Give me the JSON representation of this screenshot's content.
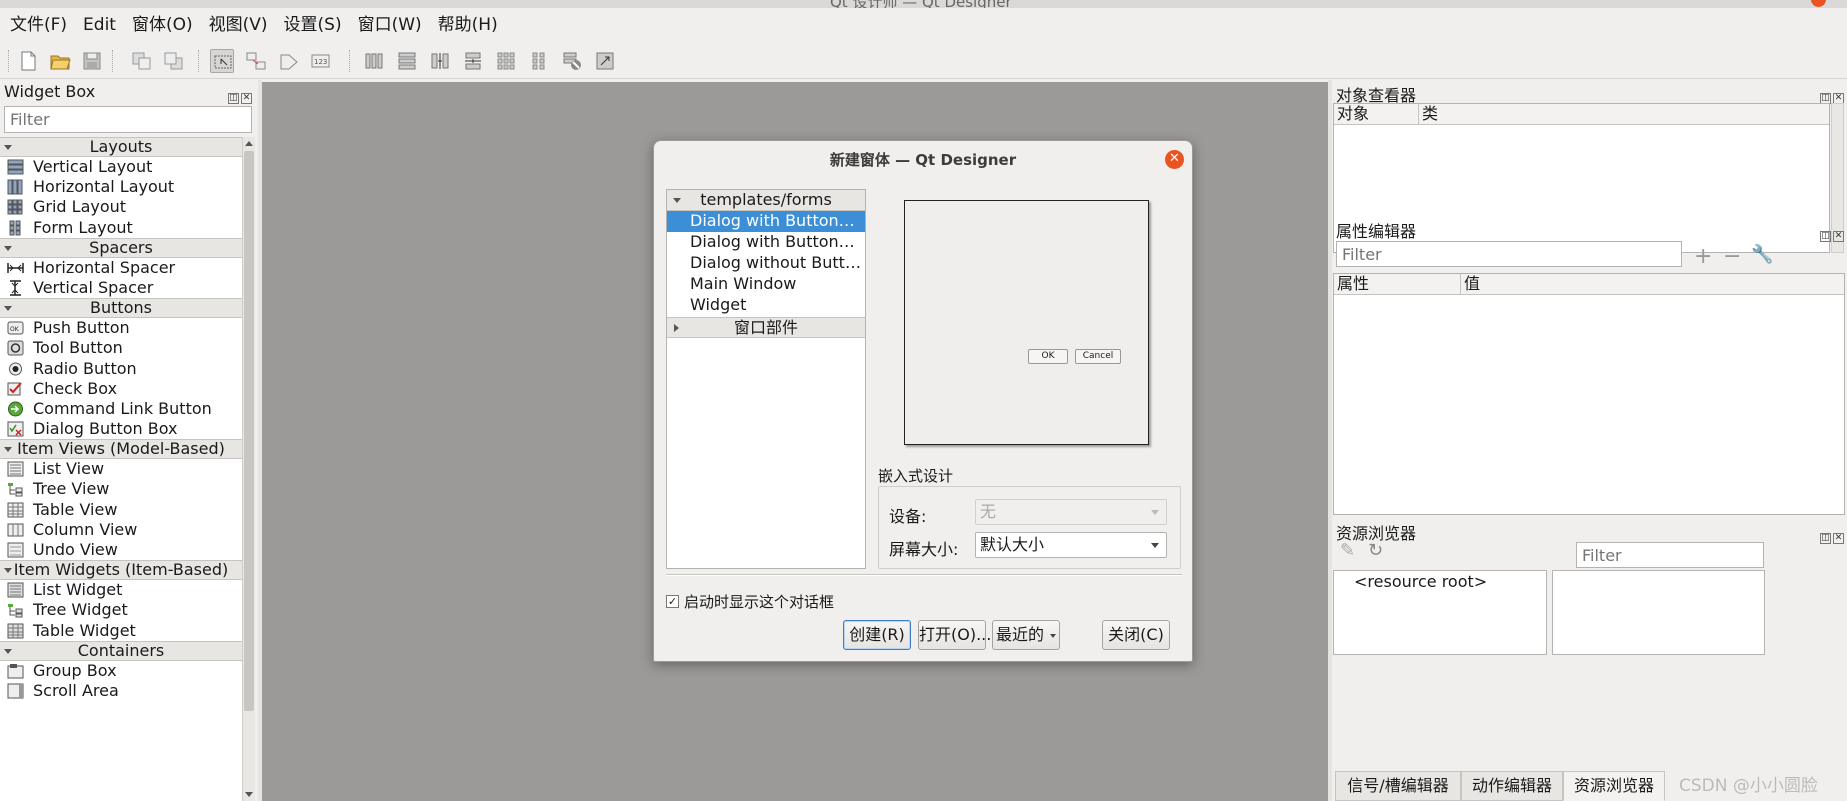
{
  "window": {
    "title": "Qt 设计师 — Qt Designer"
  },
  "menubar": [
    "文件(F)",
    "Edit",
    "窗体(O)",
    "视图(V)",
    "设置(S)",
    "窗口(W)",
    "帮助(H)"
  ],
  "widget_box": {
    "title": "Widget Box",
    "filter_placeholder": "Filter",
    "categories": [
      {
        "name": "Layouts",
        "items": [
          {
            "label": "Vertical Layout",
            "icon": "vertical-layout-icon"
          },
          {
            "label": "Horizontal Layout",
            "icon": "horizontal-layout-icon"
          },
          {
            "label": "Grid Layout",
            "icon": "grid-layout-icon"
          },
          {
            "label": "Form Layout",
            "icon": "form-layout-icon"
          }
        ]
      },
      {
        "name": "Spacers",
        "items": [
          {
            "label": "Horizontal Spacer",
            "icon": "horizontal-spacer-icon"
          },
          {
            "label": "Vertical Spacer",
            "icon": "vertical-spacer-icon"
          }
        ]
      },
      {
        "name": "Buttons",
        "items": [
          {
            "label": "Push Button",
            "icon": "push-button-icon"
          },
          {
            "label": "Tool Button",
            "icon": "tool-button-icon"
          },
          {
            "label": "Radio Button",
            "icon": "radio-button-icon"
          },
          {
            "label": "Check Box",
            "icon": "check-box-icon"
          },
          {
            "label": "Command Link Button",
            "icon": "command-link-icon"
          },
          {
            "label": "Dialog Button Box",
            "icon": "dialog-button-box-icon"
          }
        ]
      },
      {
        "name": "Item Views (Model-Based)",
        "items": [
          {
            "label": "List View",
            "icon": "list-view-icon"
          },
          {
            "label": "Tree View",
            "icon": "tree-view-icon"
          },
          {
            "label": "Table View",
            "icon": "table-view-icon"
          },
          {
            "label": "Column View",
            "icon": "column-view-icon"
          },
          {
            "label": "Undo View",
            "icon": "undo-view-icon"
          }
        ]
      },
      {
        "name": "Item Widgets (Item-Based)",
        "items": [
          {
            "label": "List Widget",
            "icon": "list-widget-icon"
          },
          {
            "label": "Tree Widget",
            "icon": "tree-widget-icon"
          },
          {
            "label": "Table Widget",
            "icon": "table-widget-icon"
          }
        ]
      },
      {
        "name": "Containers",
        "items": [
          {
            "label": "Group Box",
            "icon": "group-box-icon"
          },
          {
            "label": "Scroll Area",
            "icon": "scroll-area-icon"
          }
        ]
      }
    ]
  },
  "dialog": {
    "title": "新建窗体 — Qt Designer",
    "tree": {
      "group1": "templates/forms",
      "items": [
        "Dialog with Button…",
        "Dialog with Button…",
        "Dialog without Butt…",
        "Main Window",
        "Widget"
      ],
      "group2": "窗口部件"
    },
    "preview": {
      "ok": "OK",
      "cancel": "Cancel"
    },
    "embedded": {
      "title": "嵌入式设计",
      "device_label": "设备:",
      "device_value": "无",
      "screen_label": "屏幕大小:",
      "screen_value": "默认大小"
    },
    "show_on_startup": "启动时显示这个对话框",
    "buttons": {
      "create": "创建(R)",
      "open": "打开(O)...",
      "recent": "最近的",
      "close": "关闭(C)"
    }
  },
  "object_inspector": {
    "title": "对象查看器",
    "col_object": "对象",
    "col_class": "类"
  },
  "property_editor": {
    "title": "属性编辑器",
    "filter_placeholder": "Filter",
    "col_property": "属性",
    "col_value": "值"
  },
  "resource_browser": {
    "title": "资源浏览器",
    "filter_placeholder": "Filter",
    "root": "<resource root>"
  },
  "bottom_tabs": [
    "信号/槽编辑器",
    "动作编辑器",
    "资源浏览器"
  ],
  "watermark": "CSDN @小小圆脸",
  "colors": {
    "selection": "#3c8ed6",
    "close_button": "#e95420",
    "canvas": "#9b9a98"
  }
}
